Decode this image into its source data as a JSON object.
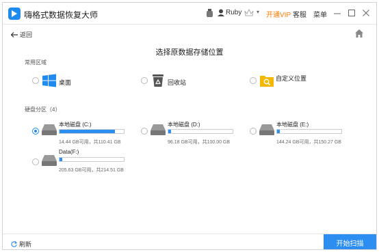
{
  "app": {
    "title": "嗨格式数据恢复大师"
  },
  "titlebar": {
    "user": "Ruby",
    "vip": "开通VIP",
    "service": "客服",
    "menu": "菜单"
  },
  "nav": {
    "back": "返回"
  },
  "page": {
    "title": "选择原数据存储位置"
  },
  "common": {
    "heading": "常用区域",
    "items": [
      {
        "label": "桌面",
        "icon": "windows-icon"
      },
      {
        "label": "回收站",
        "icon": "recycle-bin-icon"
      },
      {
        "label": "自定义位置",
        "icon": "folder-search-icon"
      }
    ]
  },
  "drives": {
    "heading": "硬盘分区（4）",
    "items": [
      {
        "name": "本地磁盘 (C:)",
        "usage": 0.86,
        "size": "14.44 GB可用，共110.41 GB",
        "selected": true
      },
      {
        "name": "本地磁盘 (D:)",
        "usage": 0.04,
        "size": "96.18 GB可用，共100.00 GB",
        "selected": false
      },
      {
        "name": "本地磁盘 (E:)",
        "usage": 0.04,
        "size": "144.24 GB可用，共150.27 GB",
        "selected": false
      },
      {
        "name": "Data(F:)",
        "usage": 0.04,
        "size": "205.63 GB可用，共214.51 GB",
        "selected": false
      }
    ]
  },
  "footer": {
    "refresh": "刷新",
    "start": "开始扫描"
  },
  "colors": {
    "accent": "#2b8ef0",
    "vip": "#ff7a00"
  }
}
